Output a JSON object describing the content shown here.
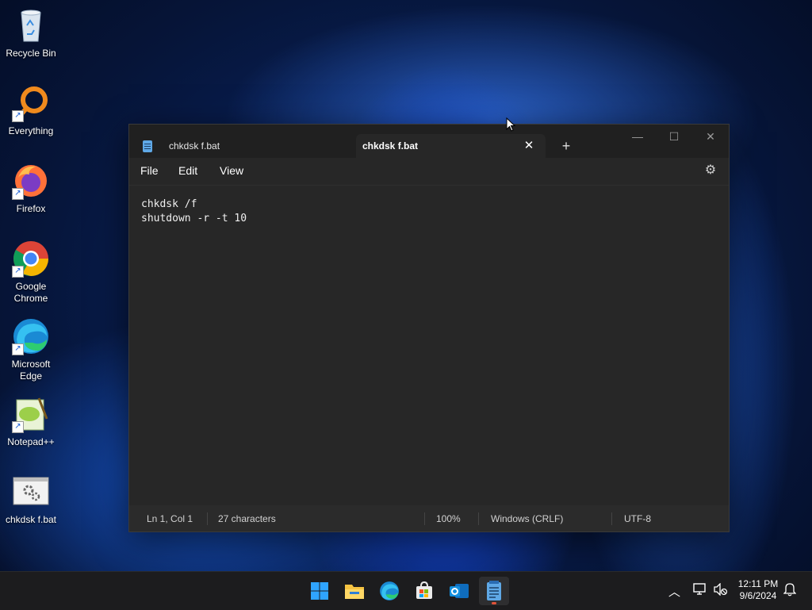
{
  "desktop": {
    "icons": [
      {
        "label": "Recycle Bin",
        "icon": "recycle-bin-icon"
      },
      {
        "label": "Everything",
        "icon": "everything-search-icon"
      },
      {
        "label": "Firefox",
        "icon": "firefox-icon"
      },
      {
        "label": "Google Chrome",
        "icon": "chrome-icon"
      },
      {
        "label": "Microsoft Edge",
        "icon": "edge-icon"
      },
      {
        "label": "Notepad++",
        "icon": "notepadplusplus-icon"
      },
      {
        "label": "chkdsk f.bat",
        "icon": "batch-file-icon"
      }
    ]
  },
  "notepad": {
    "tabs": [
      {
        "label": "chkdsk f.bat",
        "active": false
      },
      {
        "label": "chkdsk f.bat",
        "active": true
      }
    ],
    "new_tab_label": "+",
    "menu": [
      "File",
      "Edit",
      "View"
    ],
    "content": "chkdsk /f\nshutdown -r -t 10",
    "status": {
      "position": "Ln 1, Col 1",
      "characters": "27 characters",
      "zoom": "100%",
      "line_endings": "Windows (CRLF)",
      "encoding": "UTF-8"
    },
    "colors": {
      "background": "#272727",
      "titlebar": "#202020",
      "text": "#f0f0f0"
    }
  },
  "taskbar": {
    "apps": [
      "start-icon",
      "file-explorer-icon",
      "edge-icon",
      "store-icon",
      "outlook-icon",
      "notepad-icon"
    ],
    "clock": {
      "time": "12:11 PM",
      "date": "9/6/2024"
    }
  }
}
